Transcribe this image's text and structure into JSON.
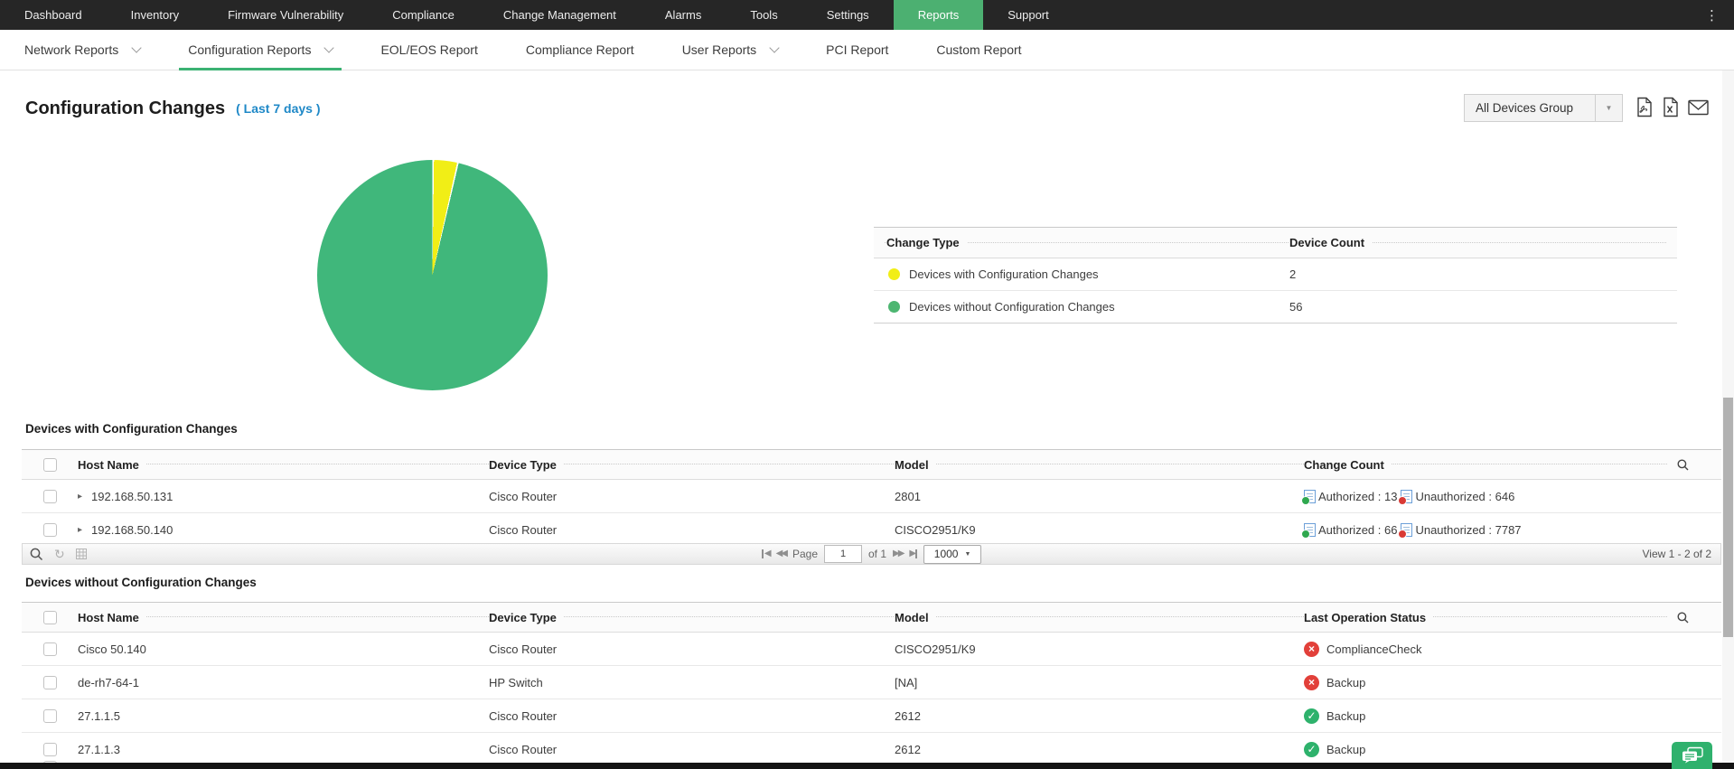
{
  "topnav": {
    "items": [
      "Dashboard",
      "Inventory",
      "Firmware Vulnerability",
      "Compliance",
      "Change Management",
      "Alarms",
      "Tools",
      "Settings",
      "Reports",
      "Support"
    ],
    "active_item": "Reports"
  },
  "subnav": {
    "items": [
      {
        "label": "Network Reports"
      },
      {
        "label": "Configuration Reports"
      },
      {
        "label": "EOL/EOS Report"
      },
      {
        "label": "Compliance Report"
      },
      {
        "label": "User Reports"
      },
      {
        "label": "PCI Report"
      },
      {
        "label": "Custom Report"
      }
    ],
    "active_item": "Configuration Reports"
  },
  "header": {
    "title": "Configuration Changes",
    "period": "( Last 7 days )",
    "device_group_selector": "All Devices Group"
  },
  "chart_data": {
    "type": "pie",
    "title": "Configuration Changes ( Last 7 days )",
    "labels": [
      "Devices with Configuration Changes",
      "Devices without Configuration Changes"
    ],
    "values": [
      2,
      56
    ],
    "colors": [
      "#f1ee16",
      "#40b77b"
    ],
    "legend_position": "right"
  },
  "legend_table": {
    "columns": [
      "Change Type",
      "Device Count"
    ],
    "rows": [
      {
        "label": "Devices with Configuration Changes",
        "count": "2",
        "color": "#f1ee16"
      },
      {
        "label": "Devices without Configuration Changes",
        "count": "56",
        "color": "#4db671"
      }
    ]
  },
  "table1": {
    "title": "Devices with Configuration Changes",
    "columns": [
      "Host Name",
      "Device Type",
      "Model",
      "Change Count"
    ],
    "rows": [
      {
        "host": "192.168.50.131",
        "device_type": "Cisco Router",
        "model": "2801",
        "authorized": "Authorized : 13",
        "unauthorized": "Unauthorized : 646",
        "authorized_color": "#2fa84f",
        "unauthorized_color": "#d93a35"
      },
      {
        "host": "192.168.50.140",
        "device_type": "Cisco Router",
        "model": "CISCO2951/K9",
        "authorized": "Authorized : 66",
        "unauthorized": "Unauthorized : 7787",
        "authorized_color": "#2fa84f",
        "unauthorized_color": "#d93a35"
      }
    ]
  },
  "pagination": {
    "page_label": "Page",
    "page_value": "1",
    "of_label": "of 1",
    "page_size": "1000",
    "view_status": "View 1 - 2 of 2"
  },
  "table2": {
    "title": "Devices without Configuration Changes",
    "columns": [
      "Host Name",
      "Device Type",
      "Model",
      "Last Operation Status"
    ],
    "rows": [
      {
        "host": "Cisco 50.140",
        "device_type": "Cisco Router",
        "model": "CISCO2951/K9",
        "status": "ComplianceCheck",
        "status_glyph": "×",
        "status_color": "#e2403a"
      },
      {
        "host": "de-rh7-64-1",
        "device_type": "HP Switch",
        "model": "[NA]",
        "status": "Backup",
        "status_glyph": "×",
        "status_color": "#e2403a"
      },
      {
        "host": "27.1.1.5",
        "device_type": "Cisco Router",
        "model": "2612",
        "status": "Backup",
        "status_glyph": "✓",
        "status_color": "#2eb26c"
      },
      {
        "host": "27.1.1.3",
        "device_type": "Cisco Router",
        "model": "2612",
        "status": "Backup",
        "status_glyph": "✓",
        "status_color": "#2eb26c"
      }
    ]
  },
  "icons": {
    "overflow_menu": "⋮",
    "expand_row": "▸",
    "pager_first": "◀",
    "pager_prev": "◀◀",
    "pager_next": "▶▶",
    "pager_last": "▶",
    "select_arrow": "▼",
    "refresh": "↻"
  }
}
